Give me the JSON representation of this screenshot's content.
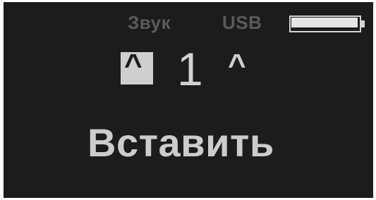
{
  "status_bar": {
    "sound_label": "Звук",
    "connection_label": "USB",
    "battery_level_fraction": 0.98
  },
  "selector": {
    "left_arrow": "^",
    "value": "1",
    "right_arrow": "^"
  },
  "action_label": "Вставить",
  "colors": {
    "screen_background": "#1c1c1c",
    "dim_text": "#5a5a5a",
    "bright_text": "#cccccc"
  }
}
